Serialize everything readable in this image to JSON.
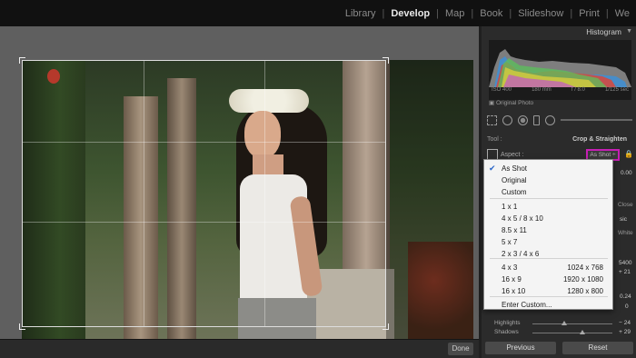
{
  "modules": [
    "Library",
    "Develop",
    "Map",
    "Book",
    "Slideshow",
    "Print",
    "We"
  ],
  "active_module": "Develop",
  "histogram": {
    "title": "Histogram",
    "iso": "ISO 400",
    "focal": "180 mm",
    "aperture": "f / 8.0",
    "shutter": "1/125 sec",
    "original_photo": "Original Photo"
  },
  "tool_label": "Tool :",
  "crop_label": "Crop & Straighten",
  "aspect_label": "Aspect :",
  "aspect_value": "As Shot ÷",
  "panel_fragments": {
    "angle_value": "0.00",
    "close": "Close",
    "basic": "sic",
    "white": "White",
    "v400": "5400",
    "v21": "+ 21",
    "v024": "0.24",
    "v0": "0"
  },
  "dropdown": {
    "selected": "As Shot",
    "groups": [
      [
        {
          "label": "As Shot",
          "dims": ""
        },
        {
          "label": "Original",
          "dims": ""
        },
        {
          "label": "Custom",
          "dims": ""
        }
      ],
      [
        {
          "label": "1 x 1",
          "dims": ""
        },
        {
          "label": "4 x 5  /  8 x 10",
          "dims": ""
        },
        {
          "label": "8.5 x 11",
          "dims": ""
        },
        {
          "label": "5 x 7",
          "dims": ""
        },
        {
          "label": "2 x 3  /  4 x 6",
          "dims": ""
        }
      ],
      [
        {
          "label": "4 x 3",
          "dims": "1024 x 768"
        },
        {
          "label": "16 x 9",
          "dims": "1920 x 1080"
        },
        {
          "label": "16 x 10",
          "dims": "1280 x 800"
        }
      ],
      [
        {
          "label": "Enter Custom...",
          "dims": ""
        }
      ]
    ]
  },
  "sliders": [
    {
      "label": "Highlights",
      "value": "− 24",
      "level": 0.4
    },
    {
      "label": "Shadows",
      "value": "+ 29",
      "level": 0.62
    }
  ],
  "buttons": {
    "previous": "Previous",
    "reset": "Reset",
    "done": "Done"
  }
}
